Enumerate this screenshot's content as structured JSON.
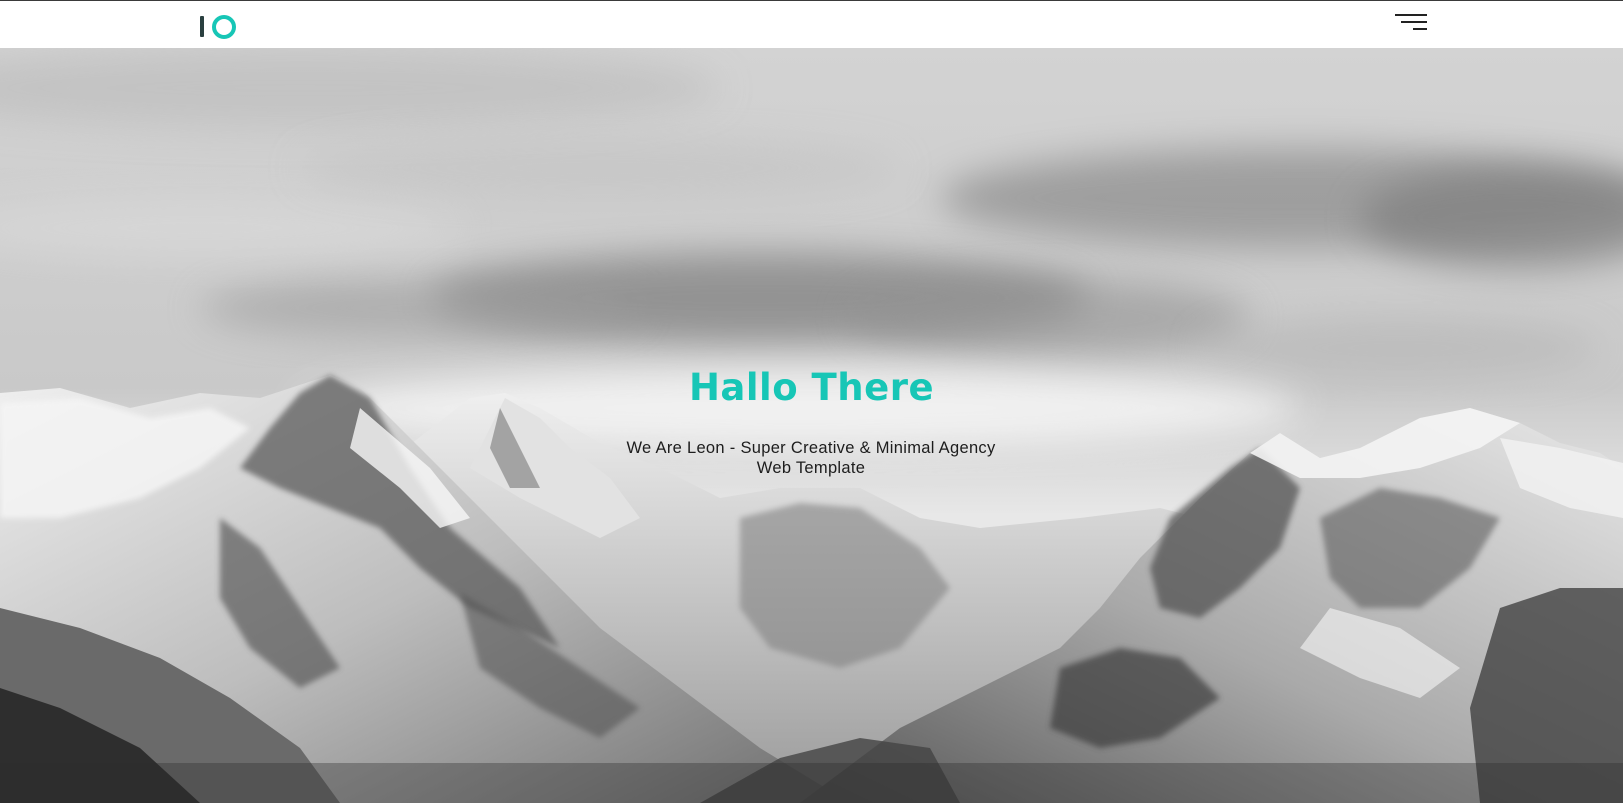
{
  "header": {
    "logo_icon": "io-logo",
    "menu_icon": "hamburger-menu-icon"
  },
  "hero": {
    "title": "Hallo There",
    "subtitle": "We Are Leon - Super Creative & Minimal Agency Web Template",
    "background": "black-and-white snowy mountain range under clouds"
  },
  "colors": {
    "accent": "#17c6b6",
    "logo_dark": "#2a4040",
    "text_dark": "#1d1d1d",
    "header_bg": "#ffffff"
  }
}
